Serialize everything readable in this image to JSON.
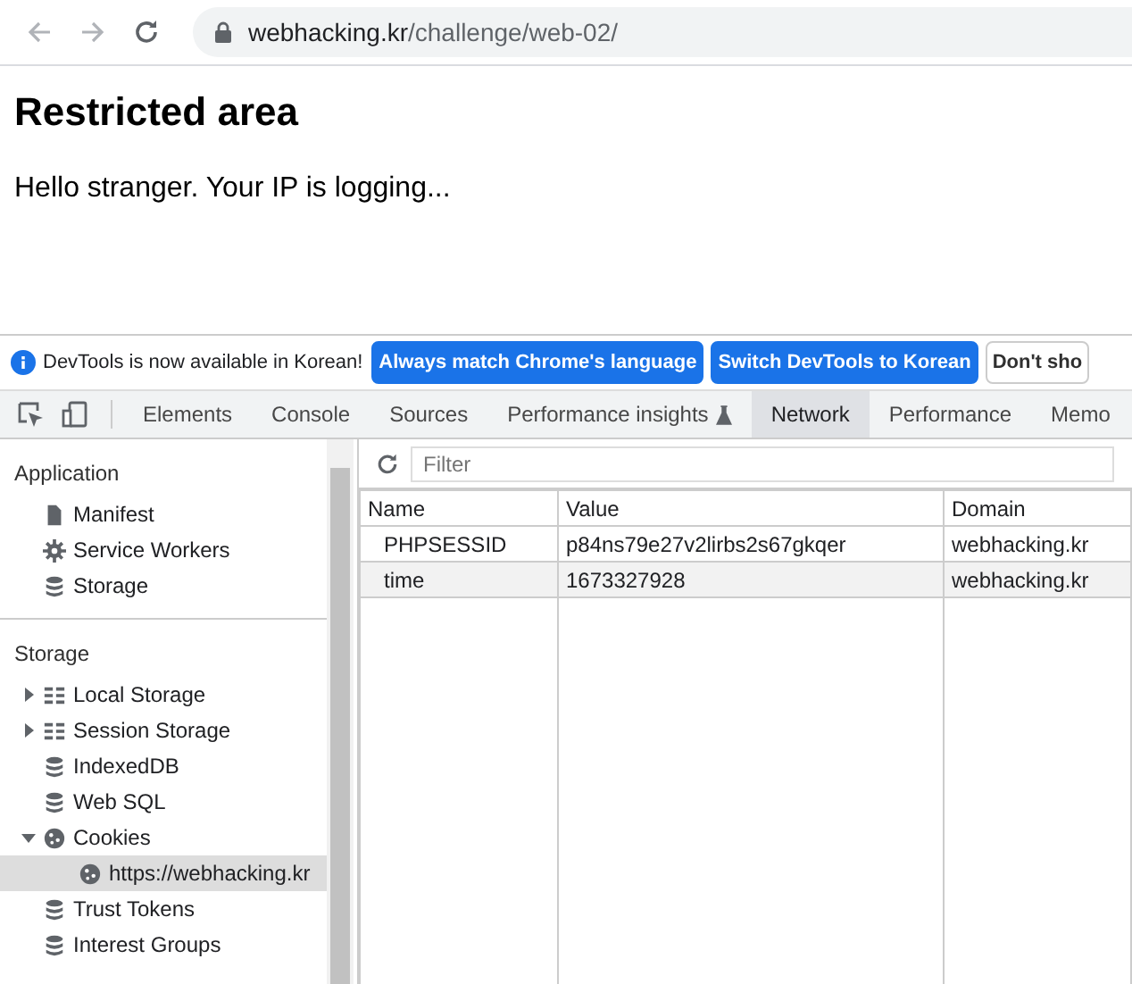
{
  "browser": {
    "url": {
      "host": "webhacking.kr",
      "path": "/challenge/web-02/"
    }
  },
  "page": {
    "heading": "Restricted area",
    "message": "Hello stranger. Your IP is logging..."
  },
  "infobar": {
    "message": "DevTools is now available in Korean!",
    "buttons": [
      {
        "label": "Always match Chrome's language",
        "kind": "primary"
      },
      {
        "label": "Switch DevTools to Korean",
        "kind": "primary"
      },
      {
        "label": "Don't sho",
        "kind": "plain"
      }
    ]
  },
  "tabs": [
    {
      "label": "Elements",
      "selected": false
    },
    {
      "label": "Console",
      "selected": false
    },
    {
      "label": "Sources",
      "selected": false
    },
    {
      "label": "Performance insights",
      "selected": false,
      "experimental": true
    },
    {
      "label": "Network",
      "selected": true
    },
    {
      "label": "Performance",
      "selected": false
    },
    {
      "label": "Memo",
      "selected": false
    }
  ],
  "sidebar": {
    "sections": [
      {
        "title": "Application",
        "items": [
          {
            "label": "Manifest",
            "kind": "file",
            "selected": false
          },
          {
            "label": "Service Workers",
            "kind": "gear",
            "selected": false
          },
          {
            "label": "Storage",
            "kind": "db",
            "selected": false
          }
        ]
      },
      {
        "title": "Storage",
        "items": [
          {
            "label": "Local Storage",
            "kind": "grid",
            "selected": false,
            "expanded": false
          },
          {
            "label": "Session Storage",
            "kind": "grid",
            "selected": false,
            "expanded": false
          },
          {
            "label": "IndexedDB",
            "kind": "db",
            "selected": false
          },
          {
            "label": "Web SQL",
            "kind": "db",
            "selected": false
          },
          {
            "label": "Cookies",
            "kind": "cookie",
            "selected": false,
            "expanded": true,
            "children": [
              {
                "label": "https://webhacking.kr",
                "kind": "cookie",
                "selected": true
              }
            ]
          },
          {
            "label": "Trust Tokens",
            "kind": "db",
            "selected": false
          },
          {
            "label": "Interest Groups",
            "kind": "db",
            "selected": false
          }
        ]
      }
    ]
  },
  "filter": {
    "placeholder": "Filter"
  },
  "table": {
    "columns": [
      "Name",
      "Value",
      "Domain"
    ],
    "rows": [
      [
        "PHPSESSID",
        "p84ns79e27v2lirbs2s67gkqer",
        "webhacking.kr"
      ],
      [
        "time",
        "1673327928",
        "webhacking.kr"
      ]
    ]
  }
}
